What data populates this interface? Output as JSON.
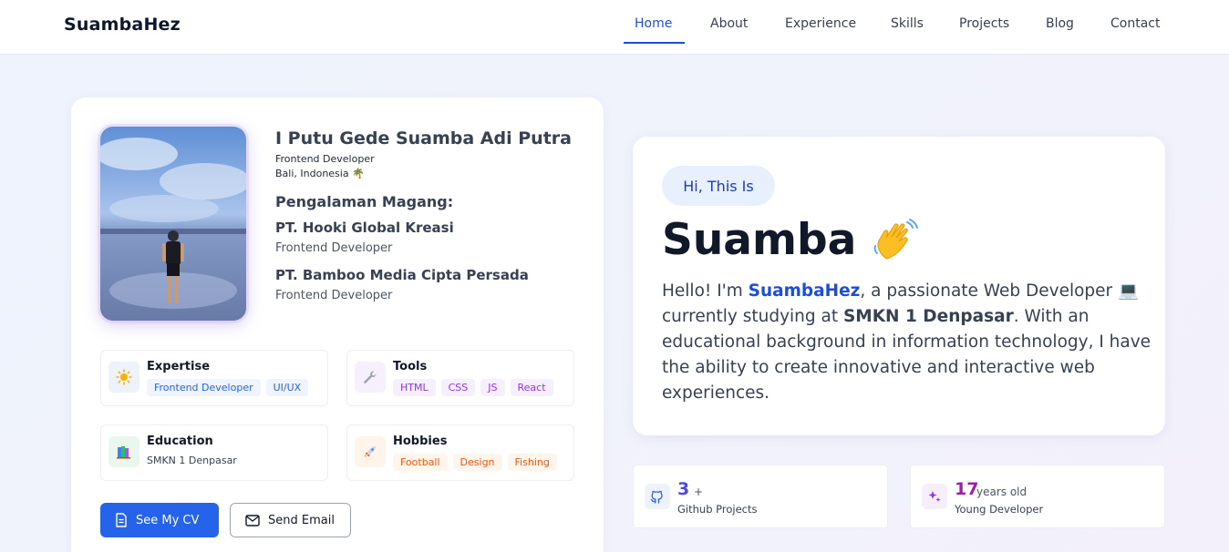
{
  "brand": "SuambaHez",
  "nav": {
    "items": [
      "Home",
      "About",
      "Experience",
      "Skills",
      "Projects",
      "Blog",
      "Contact"
    ],
    "active": "Home"
  },
  "profile": {
    "name": "I Putu Gede Suamba Adi Putra",
    "title": "Frontend Developer",
    "location": "Bali, Indonesia",
    "location_emoji": "🌴",
    "internship_heading": "Pengalaman Magang:",
    "internships": [
      {
        "company": "PT. Hooki Global Kreasi",
        "role": "Frontend Developer"
      },
      {
        "company": "PT. Bamboo Media Cipta Persada",
        "role": "Frontend Developer"
      }
    ]
  },
  "info": {
    "expertise": {
      "title": "Expertise",
      "icon": "sun-icon",
      "tags": [
        "Frontend Developer",
        "UI/UX"
      ]
    },
    "tools": {
      "title": "Tools",
      "icon": "wrench-icon",
      "tags": [
        "HTML",
        "CSS",
        "JS",
        "React"
      ]
    },
    "education": {
      "title": "Education",
      "icon": "books-icon",
      "value": "SMKN 1 Denpasar"
    },
    "hobbies": {
      "title": "Hobbies",
      "icon": "rocket-icon",
      "tags": [
        "Football",
        "Design",
        "Fishing"
      ]
    }
  },
  "buttons": {
    "cv": "See My CV",
    "email": "Send Email"
  },
  "hero": {
    "greeting": "Hi, This Is",
    "name": "Suamba",
    "wave_emoji": "👋",
    "intro_1": "Hello! I'm ",
    "brand_highlight": "SuambaHez",
    "intro_2": ", a passionate Web Developer ",
    "laptop_emoji": "💻",
    "intro_3": " currently studying at ",
    "school": "SMKN 1 Denpasar",
    "intro_4": ". With an educational background in information technology, I have the ability to create innovative and interactive web experiences."
  },
  "stats": [
    {
      "value": "3",
      "suffix": "+",
      "label": "Github Projects",
      "icon": "github-icon",
      "color": "#4f46e5"
    },
    {
      "value": "17",
      "suffix": "years old",
      "label": "Young Developer",
      "icon": "sparkle-icon",
      "color": "#a21caf"
    }
  ],
  "colors": {
    "accent": "#2563eb",
    "nav_active": "#1d4ed8"
  }
}
